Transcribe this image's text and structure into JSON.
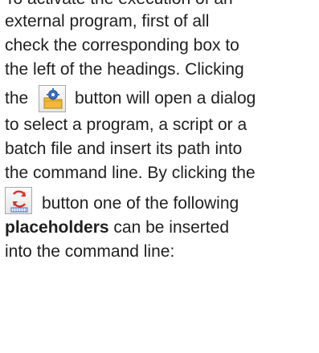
{
  "paragraph": {
    "line_0": "To activate the execution of an",
    "line_1": "external program, first of all",
    "line_2": "check the corresponding box to",
    "line_3": "the left of the headings. Clicking",
    "line_4_before": "the",
    "line_4_after": "button will open a dialog",
    "line_5": "to select a program, a script or a",
    "line_6": "batch file and insert its path into",
    "line_7": "the command line. By clicking the",
    "line_8_after": "button one of the following",
    "line_9_bold": "placeholders",
    "line_9_after": " can be inserted",
    "line_10": "into the command line:"
  },
  "icons": {
    "program_button": "folder-gear-icon",
    "placeholder_button": "placeholder-insert-icon"
  },
  "colors": {
    "text": "#1f1f1f",
    "folder": "#f1b938",
    "gear": "#3a6fc4",
    "placeholder": "#d9342b"
  }
}
